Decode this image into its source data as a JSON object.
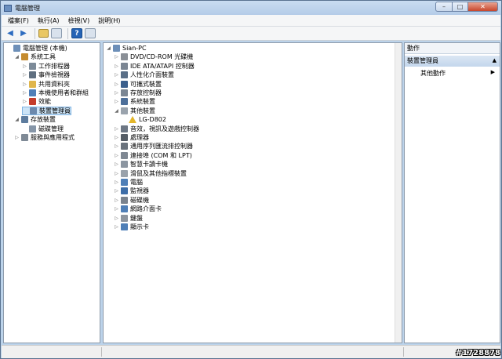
{
  "window": {
    "title": "電腦管理"
  },
  "menu": [
    "檔案(F)",
    "執行(A)",
    "檢視(V)",
    "說明(H)"
  ],
  "left_tree": [
    {
      "label": "電腦管理 (本機)",
      "arrow": "",
      "depth": 0,
      "icon": "computer-icon",
      "color": "#6d8fb8"
    },
    {
      "label": "系統工具",
      "arrow": "◢",
      "depth": 1,
      "icon": "tools-icon",
      "color": "#c58b2e"
    },
    {
      "label": "工作排程器",
      "arrow": "▷",
      "depth": 2,
      "icon": "clock-icon",
      "color": "#7d8b99"
    },
    {
      "label": "事件檢視器",
      "arrow": "▷",
      "depth": 2,
      "icon": "event-viewer-icon",
      "color": "#5f6f80"
    },
    {
      "label": "共用資料夾",
      "arrow": "▷",
      "depth": 2,
      "icon": "shared-folder-icon",
      "color": "#e0b64c"
    },
    {
      "label": "本機使用者和群組",
      "arrow": "▷",
      "depth": 2,
      "icon": "users-icon",
      "color": "#4f7fb7"
    },
    {
      "label": "效能",
      "arrow": "▷",
      "depth": 2,
      "icon": "performance-icon",
      "color": "#c43c2b"
    },
    {
      "label": "裝置管理員",
      "arrow": "",
      "depth": 2,
      "icon": "device-manager-icon",
      "color": "#6c89ad",
      "selected": true
    },
    {
      "label": "存放裝置",
      "arrow": "◢",
      "depth": 1,
      "icon": "storage-icon",
      "color": "#5d7c9e"
    },
    {
      "label": "磁碟管理",
      "arrow": "",
      "depth": 2,
      "icon": "disk-icon",
      "color": "#8696a8"
    },
    {
      "label": "服務與應用程式",
      "arrow": "▷",
      "depth": 1,
      "icon": "services-icon",
      "color": "#7f8a96"
    }
  ],
  "device_tree": [
    {
      "label": "Sian-PC",
      "arrow": "◢",
      "depth": 0,
      "icon": "computer-icon",
      "color": "#6d8fb8"
    },
    {
      "label": "DVD/CD-ROM 光碟機",
      "arrow": "▷",
      "depth": 1,
      "icon": "dvd-drive-icon",
      "color": "#8a8f96"
    },
    {
      "label": "IDE ATA/ATAPI 控制器",
      "arrow": "▷",
      "depth": 1,
      "icon": "ide-controller-icon",
      "color": "#7b8693"
    },
    {
      "label": "人性化介面裝置",
      "arrow": "▷",
      "depth": 1,
      "icon": "hid-icon",
      "color": "#5a6f87"
    },
    {
      "label": "可攜式裝置",
      "arrow": "▷",
      "depth": 1,
      "icon": "portable-device-icon",
      "color": "#3b5f8c"
    },
    {
      "label": "存放控制器",
      "arrow": "▷",
      "depth": 1,
      "icon": "storage-controller-icon",
      "color": "#7b8693"
    },
    {
      "label": "系統裝置",
      "arrow": "▷",
      "depth": 1,
      "icon": "system-device-icon",
      "color": "#4d6f9a"
    },
    {
      "label": "其他裝置",
      "arrow": "◢",
      "depth": 1,
      "icon": "other-devices-icon",
      "color": "#9aa3ad"
    },
    {
      "label": "LG-D802",
      "arrow": "",
      "depth": 2,
      "icon": "warning-icon",
      "color": "#e3b62a"
    },
    {
      "label": "音效，視訊及遊戲控制器",
      "arrow": "▷",
      "depth": 1,
      "icon": "sound-icon",
      "color": "#6d7784"
    },
    {
      "label": "處理器",
      "arrow": "▷",
      "depth": 1,
      "icon": "processor-icon",
      "color": "#555d66"
    },
    {
      "label": "通用序列匯流排控制器",
      "arrow": "▷",
      "depth": 1,
      "icon": "usb-icon",
      "color": "#6a737d"
    },
    {
      "label": "連接埠 (COM 和 LPT)",
      "arrow": "▷",
      "depth": 1,
      "icon": "port-icon",
      "color": "#7f8893"
    },
    {
      "label": "智慧卡讀卡機",
      "arrow": "▷",
      "depth": 1,
      "icon": "smartcard-icon",
      "color": "#8c96a1"
    },
    {
      "label": "滑鼠及其他指標裝置",
      "arrow": "▷",
      "depth": 1,
      "icon": "mouse-icon",
      "color": "#9aa2ab"
    },
    {
      "label": "電腦",
      "arrow": "▷",
      "depth": 1,
      "icon": "computer-icon",
      "color": "#4f7fb7"
    },
    {
      "label": "監視器",
      "arrow": "▷",
      "depth": 1,
      "icon": "monitor-icon",
      "color": "#3e6ea8"
    },
    {
      "label": "磁碟機",
      "arrow": "▷",
      "depth": 1,
      "icon": "disk-drive-icon",
      "color": "#7a838e"
    },
    {
      "label": "網路介面卡",
      "arrow": "▷",
      "depth": 1,
      "icon": "network-adapter-icon",
      "color": "#4f7fb7"
    },
    {
      "label": "鍵盤",
      "arrow": "▷",
      "depth": 1,
      "icon": "keyboard-icon",
      "color": "#8d959f"
    },
    {
      "label": "顯示卡",
      "arrow": "▷",
      "depth": 1,
      "icon": "display-adapter-icon",
      "color": "#4f7fb7"
    }
  ],
  "actions": {
    "header": "動作",
    "section": "裝置管理員",
    "section_caret": "▲",
    "item": "其他動作",
    "item_arrow": "▶"
  },
  "watermark": "#1728878"
}
